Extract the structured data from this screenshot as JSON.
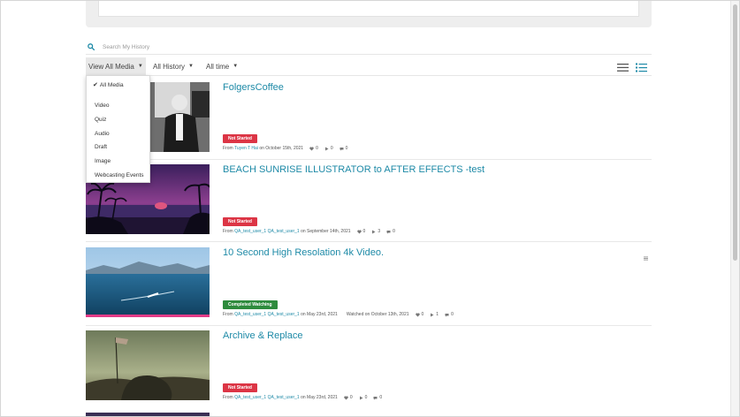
{
  "search": {
    "placeholder": "Search My History"
  },
  "filters": {
    "media": "View All Media",
    "history": "All History",
    "time": "All time"
  },
  "dropdown": {
    "items": [
      {
        "label": "All Media",
        "selected": true
      },
      {
        "label": "Video"
      },
      {
        "label": "Quiz"
      },
      {
        "label": "Audio"
      },
      {
        "label": "Draft"
      },
      {
        "label": "Image"
      },
      {
        "label": "Webcasting Events"
      }
    ],
    "check": "✔"
  },
  "entries": [
    {
      "title": "FolgersCoffee",
      "status": "Not Started",
      "from_prefix": "From",
      "owner": "Tuyen T Hai",
      "date_text": "on October 15th, 2021",
      "likes": "0",
      "plays": "0",
      "comments": "0"
    },
    {
      "title": "BEACH SUNRISE ILLUSTRATOR to AFTER EFFECTS -test",
      "status": "Not Started",
      "from_prefix": "From",
      "owner": "QA_test_user_1 QA_test_user_1",
      "date_text": "on September 14th, 2021",
      "likes": "0",
      "plays": "3",
      "comments": "0"
    },
    {
      "title": "10 Second High Resolation 4k Video.",
      "status": "Completed Watching",
      "from_prefix": "From",
      "owner": "QA_test_user_1 QA_test_user_1",
      "date_text": "on May 23rd, 2021",
      "watched_text": "Watched on October 13th, 2021",
      "likes": "0",
      "plays": "1",
      "comments": "0"
    },
    {
      "title": "Archive & Replace",
      "status": "Not Started",
      "from_prefix": "From",
      "owner": "QA_test_user_1 QA_test_user_1",
      "date_text": "on May 23rd, 2021",
      "likes": "0",
      "plays": "0",
      "comments": "0"
    }
  ],
  "colors": {
    "accent": "#1e8aa7",
    "status_red": "#dc3545",
    "status_green": "#2e8b3d",
    "progress_pink": "#e23b87"
  }
}
